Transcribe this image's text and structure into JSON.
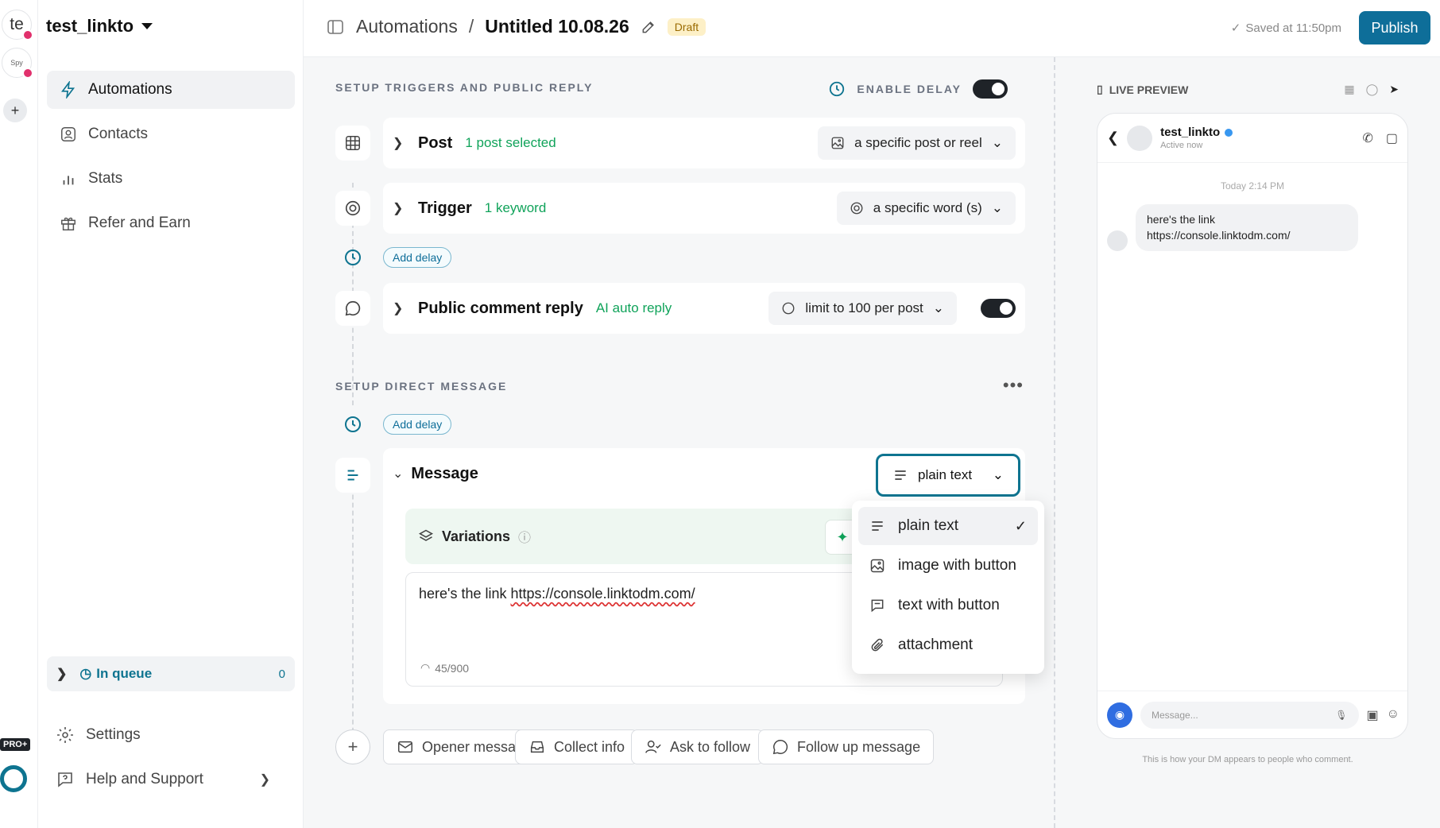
{
  "rail": {
    "account_initials": "te",
    "account2_label": "Spy",
    "pro_badge": "PRO+"
  },
  "sidebar": {
    "workspace": "test_linkto",
    "nav": [
      {
        "label": "Automations",
        "icon": "bolt-icon"
      },
      {
        "label": "Contacts",
        "icon": "contact-icon"
      },
      {
        "label": "Stats",
        "icon": "bar-chart-icon"
      },
      {
        "label": "Refer and Earn",
        "icon": "gift-icon"
      }
    ],
    "queue": {
      "label": "In queue",
      "count": "0"
    },
    "settings": "Settings",
    "help": "Help and Support"
  },
  "header": {
    "breadcrumb_root": "Automations",
    "separator": "/",
    "title": "Untitled 10.08.26",
    "status": "Draft",
    "saved": "Saved at 11:50pm",
    "publish": "Publish"
  },
  "builder": {
    "triggers_label": "SETUP TRIGGERS AND PUBLIC REPLY",
    "enable_delay": "ENABLE DELAY",
    "post": {
      "title": "Post",
      "sub": "1 post selected",
      "select": "a specific post or reel"
    },
    "trigger": {
      "title": "Trigger",
      "sub": "1 keyword",
      "select": "a specific word (s)"
    },
    "add_delay": "Add delay",
    "reply": {
      "title": "Public comment reply",
      "sub": "AI auto reply",
      "select": "limit to 100 per post"
    },
    "dm_label": "SETUP DIRECT MESSAGE",
    "message": {
      "title": "Message",
      "type": "plain text",
      "variations": "Variations",
      "text_prefix": "here's the link ",
      "text_link": "https://console.linktodm.com/",
      "count": "45/900"
    },
    "add_buttons": [
      "Opener message",
      "Collect info",
      "Ask to follow",
      "Follow up message"
    ]
  },
  "dropdown": {
    "items": [
      {
        "label": "plain text",
        "icon": "lines-icon",
        "selected": true
      },
      {
        "label": "image with button",
        "icon": "image-icon",
        "selected": false
      },
      {
        "label": "text with button",
        "icon": "chat-button-icon",
        "selected": false
      },
      {
        "label": "attachment",
        "icon": "paperclip-icon",
        "selected": false
      }
    ]
  },
  "preview": {
    "label": "LIVE PREVIEW",
    "name": "test_linkto",
    "status": "Active now",
    "time": "Today 2:14 PM",
    "bubble_line1": "here's the link",
    "bubble_line2": "https://console.linktodm.com/",
    "input_placeholder": "Message...",
    "note": "This is how your DM appears to people who comment."
  },
  "colors": {
    "accent": "#0e7490",
    "publish": "#0e6e99",
    "green": "#10a35a",
    "draft_bg": "#fdf0c7"
  }
}
